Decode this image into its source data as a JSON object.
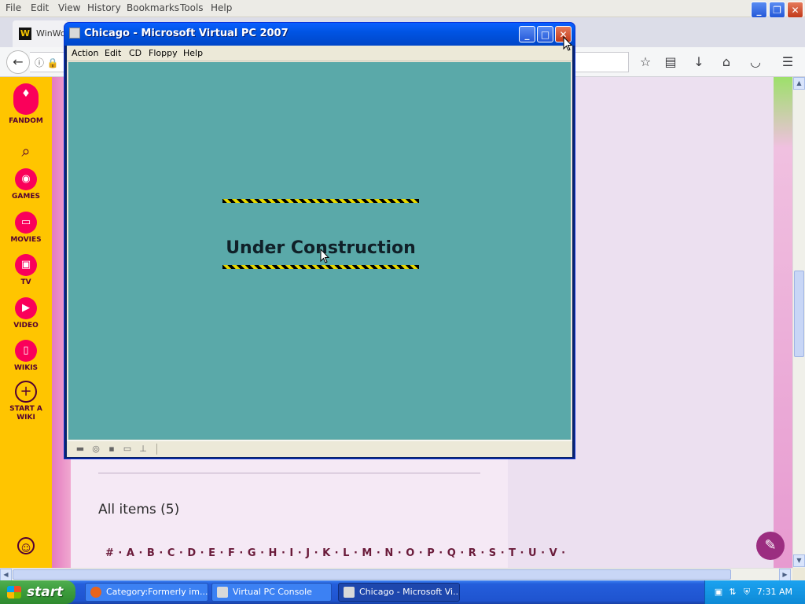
{
  "firefox": {
    "menu": [
      "File",
      "Edit",
      "View",
      "History",
      "Bookmarks",
      "Tools",
      "Help"
    ],
    "tab_label": "WinWo"
  },
  "fandom_rail": {
    "brand": "FANDOM",
    "items": [
      {
        "label": "GAMES",
        "icon": "gamepad-icon"
      },
      {
        "label": "MOVIES",
        "icon": "clapperboard-icon"
      },
      {
        "label": "TV",
        "icon": "tv-icon"
      },
      {
        "label": "VIDEO",
        "icon": "play-icon"
      },
      {
        "label": "WIKIS",
        "icon": "book-icon"
      }
    ],
    "start_wiki": "START A WIKI"
  },
  "article": {
    "all_items": "All items (5)",
    "alphabet": "# · A · B · C · D · E · F · G · H · I · J · K · L · M · N · O · P · Q · R · S · T · U · V ·"
  },
  "vpc": {
    "title": "Chicago - Microsoft Virtual PC 2007",
    "menu": [
      "Action",
      "Edit",
      "CD",
      "Floppy",
      "Help"
    ],
    "screen_text": "Under Construction",
    "screen_color": "#5aa9a9"
  },
  "taskbar": {
    "start": "start",
    "tasks": [
      "Category:Formerly im...",
      "Virtual PC Console",
      "Chicago - Microsoft Vi..."
    ],
    "clock": "7:31 AM"
  }
}
